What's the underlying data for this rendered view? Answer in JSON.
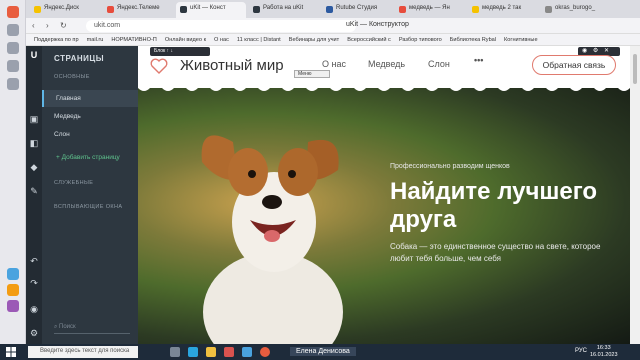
{
  "browser": {
    "tabs": [
      {
        "label": "Яндекс.Диск",
        "color": "#f5c200"
      },
      {
        "label": "Яндекс.Телеме",
        "color": "#e74c3c"
      },
      {
        "label": "uKit — Конст",
        "color": "#2d3740",
        "active": true
      },
      {
        "label": "Работа на uKit",
        "color": "#2d3740"
      },
      {
        "label": "Rutube Студия",
        "color": "#2d5aa0"
      },
      {
        "label": "медведь — Ян",
        "color": "#e74c3c"
      },
      {
        "label": "медведь 2 так",
        "color": "#f5c200"
      },
      {
        "label": "okras_burogo_",
        "color": "#888888"
      }
    ],
    "url": "ukit.com",
    "page_title": "uKit — Конструктор",
    "bookmarks": [
      "Поддержка по пр",
      "mail.ru",
      "НОРМАТИВНО-П",
      "Онлайн видео к",
      "О нас",
      "11 класс | Distant",
      "Вебинары для учит",
      "Всероссийский с",
      "Разбор типового",
      "Библиотека Rybal",
      "Когнитивные"
    ]
  },
  "editor": {
    "panel_title": "СТРАНИЦЫ",
    "section_main": "ОСНОВНЫЕ",
    "pages": [
      "Главная",
      "Медведь",
      "Слон"
    ],
    "active_page": "Главная",
    "add_page": "Добавить страницу",
    "section_service": "СЛУЖЕБНЫЕ",
    "section_popups": "ВСПЛЫВАЮЩИЕ ОКНА",
    "search_placeholder": "Поиск",
    "block_toolbar": "Блок",
    "menu_tag": "Меню"
  },
  "site": {
    "title": "Животный мир",
    "nav": [
      "О нас",
      "Медведь",
      "Слон"
    ],
    "cta": "Обратная связь",
    "tagline": "Профессионально разводим щенков",
    "headline": "Найдите лучшего друга",
    "subtext": "Собака — это единственное существо на свете, которое любит тебя больше, чем себя"
  },
  "taskbar": {
    "search_placeholder": "Введите здесь текст для поиска",
    "user": "Елена Денисова",
    "lang": "РУС",
    "time": "16:33",
    "date": "16.01.2023"
  },
  "colors": {
    "accent": "#e07a6e",
    "editor_dark": "#2d3740",
    "link_green": "#5fc38d"
  }
}
